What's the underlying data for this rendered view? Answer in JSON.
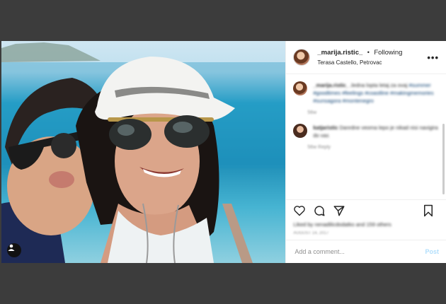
{
  "post": {
    "username": "_marija.ristic_",
    "separator": "•",
    "follow_status": "Following",
    "location": "Terasa Castello, Petrovac",
    "more_label": "•••"
  },
  "comments": [
    {
      "text_user": "_marija.ristic_",
      "text_body": "Jedna lopta letaj za ovaj ",
      "text_tags": "#summer #goodtimes #feelings #coastline #makingmemories #sunsagora #montenegro",
      "meta": "56w"
    },
    {
      "text_user": "katjaristic",
      "text_body": "Danrdne veoma lepo je nikad nisi navigira do vas",
      "meta": "56w   Reply"
    }
  ],
  "likes_text": "Liked by nenadilicdodatko and 159 others",
  "date_text": "AUGUST 14, 2017",
  "add_comment": {
    "placeholder": "Add a comment...",
    "post_label": "Post"
  },
  "icons": {
    "like": "heart-icon",
    "comment": "comment-icon",
    "share": "share-icon",
    "save": "bookmark-icon",
    "user_tag": "user-tag-icon"
  }
}
